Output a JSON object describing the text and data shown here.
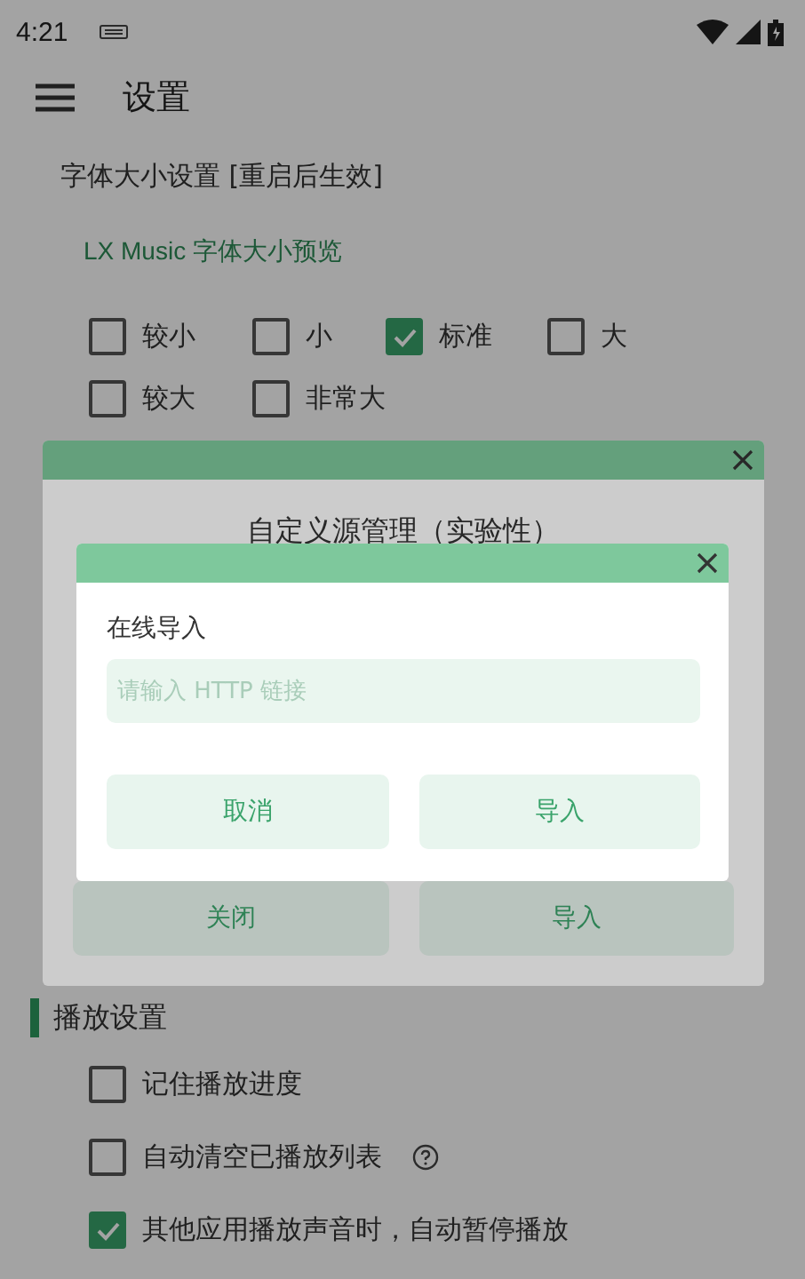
{
  "status_bar": {
    "time": "4:21"
  },
  "toolbar": {
    "title": "设置"
  },
  "font_size": {
    "heading": "字体大小设置 [重启后生效]",
    "preview": "LX Music 字体大小预览",
    "options": [
      {
        "label": "较小",
        "selected": false
      },
      {
        "label": "小",
        "selected": false
      },
      {
        "label": "标准",
        "selected": true
      },
      {
        "label": "大",
        "selected": false
      },
      {
        "label": "较大",
        "selected": false
      },
      {
        "label": "非常大",
        "selected": false
      }
    ]
  },
  "playback": {
    "heading": "播放设置",
    "options": [
      {
        "label": "记住播放进度",
        "checked": false,
        "kind": "plain"
      },
      {
        "label": "自动清空已播放列表",
        "checked": false,
        "kind": "help"
      },
      {
        "label": "其他应用播放声音时，自动暂停播放",
        "checked": true,
        "kind": "plain"
      }
    ]
  },
  "source_dialog": {
    "title": "自定义源管理（实验性）",
    "buttons": [
      "关闭",
      "导入"
    ]
  },
  "import_dialog": {
    "title": "在线导入",
    "input": {
      "placeholder": "请输入 HTTP 链接"
    },
    "buttons": [
      "取消",
      "导入"
    ]
  }
}
